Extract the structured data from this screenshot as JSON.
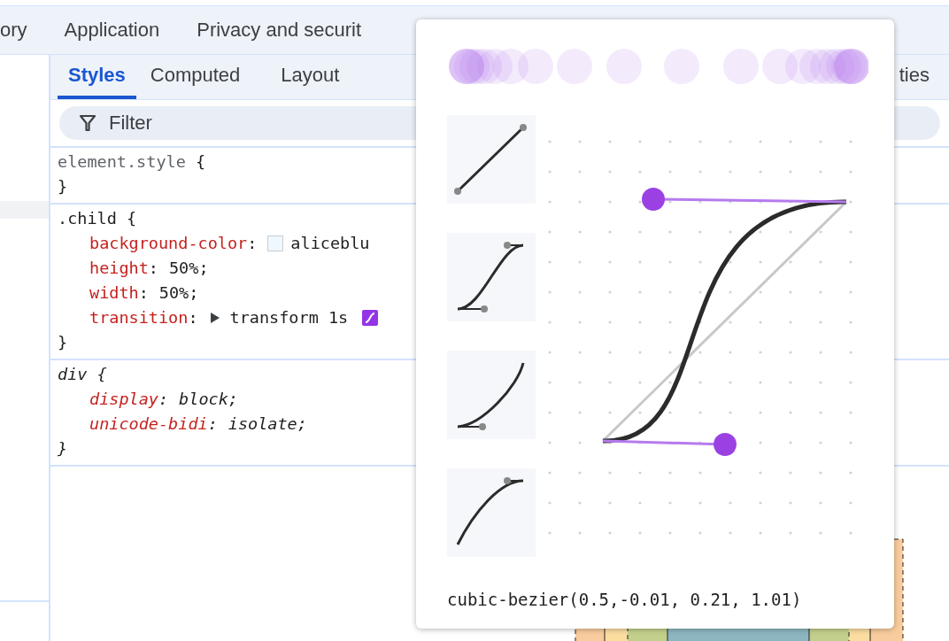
{
  "main_tabs": [
    {
      "label": "ory",
      "selected": false
    },
    {
      "label": "Application",
      "selected": false
    },
    {
      "label": "Privacy and securit",
      "selected": false
    }
  ],
  "sub_tabs": [
    {
      "label": "Styles",
      "selected": true
    },
    {
      "label": "Computed",
      "selected": false
    },
    {
      "label": "Layout",
      "selected": false
    },
    {
      "label": "ties",
      "selected": false
    }
  ],
  "filter": {
    "placeholder": "Filter"
  },
  "rules": [
    {
      "selector": "element.style",
      "kind": "inline",
      "open_brace": "{",
      "close_brace": "}"
    },
    {
      "selector": ".child",
      "kind": "author",
      "open_brace": "{",
      "close_brace": "}",
      "declarations": [
        {
          "property": "background-color",
          "separator": ":",
          "value": "aliceblu",
          "kind": "color",
          "color": "#f0f8ff"
        },
        {
          "property": "height",
          "separator": ":",
          "value": "50%;",
          "kind": "plain"
        },
        {
          "property": "width",
          "separator": ":",
          "value": "50%;",
          "kind": "plain"
        },
        {
          "property": "transition",
          "separator": ":",
          "value": "transform 1s",
          "kind": "transition",
          "expanded": false
        }
      ]
    },
    {
      "selector": "div",
      "kind": "user-agent",
      "open_brace": "{",
      "close_brace": "}",
      "declarations": [
        {
          "property": "display",
          "separator": ":",
          "value": "block;",
          "kind": "plain"
        },
        {
          "property": "unicode-bidi",
          "separator": ":",
          "value": "isolate;",
          "kind": "plain"
        }
      ]
    }
  ],
  "bezier_editor": {
    "value": "cubic-bezier(0.5,-0.01, 0.21, 1.01)"
  }
}
